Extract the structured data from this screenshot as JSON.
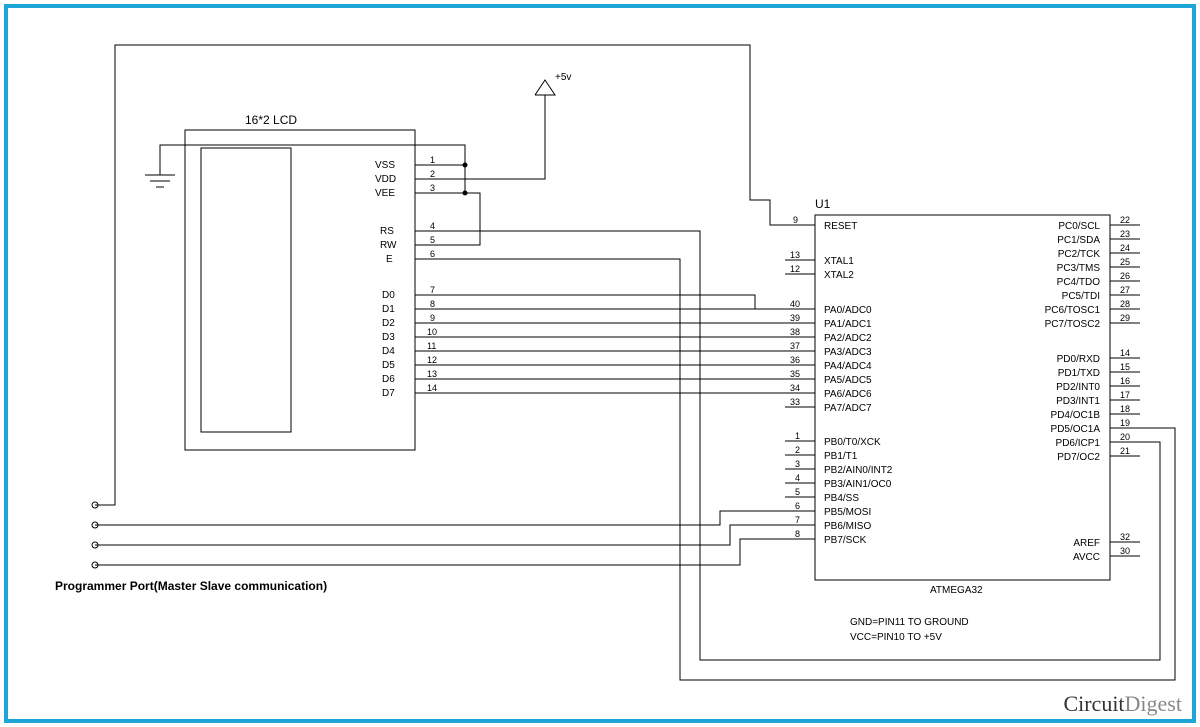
{
  "lcd": {
    "title": "16*2 LCD",
    "pins": [
      "VSS",
      "VDD",
      "VEE",
      "RS",
      "RW",
      "E",
      "D0",
      "D1",
      "D2",
      "D3",
      "D4",
      "D5",
      "D6",
      "D7"
    ]
  },
  "mcu": {
    "ref": "U1",
    "part": "ATMEGA32",
    "left": [
      {
        "num": "9",
        "label": "RESET"
      },
      {
        "num": "13",
        "label": "XTAL1"
      },
      {
        "num": "12",
        "label": "XTAL2"
      },
      {
        "num": "40",
        "label": "PA0/ADC0"
      },
      {
        "num": "39",
        "label": "PA1/ADC1"
      },
      {
        "num": "38",
        "label": "PA2/ADC2"
      },
      {
        "num": "37",
        "label": "PA3/ADC3"
      },
      {
        "num": "36",
        "label": "PA4/ADC4"
      },
      {
        "num": "35",
        "label": "PA5/ADC5"
      },
      {
        "num": "34",
        "label": "PA6/ADC6"
      },
      {
        "num": "33",
        "label": "PA7/ADC7"
      },
      {
        "num": "1",
        "label": "PB0/T0/XCK"
      },
      {
        "num": "2",
        "label": "PB1/T1"
      },
      {
        "num": "3",
        "label": "PB2/AIN0/INT2"
      },
      {
        "num": "4",
        "label": "PB3/AIN1/OC0"
      },
      {
        "num": "5",
        "label": "PB4/SS"
      },
      {
        "num": "6",
        "label": "PB5/MOSI"
      },
      {
        "num": "7",
        "label": "PB6/MISO"
      },
      {
        "num": "8",
        "label": "PB7/SCK"
      }
    ],
    "right": [
      {
        "num": "22",
        "label": "PC0/SCL"
      },
      {
        "num": "23",
        "label": "PC1/SDA"
      },
      {
        "num": "24",
        "label": "PC2/TCK"
      },
      {
        "num": "25",
        "label": "PC3/TMS"
      },
      {
        "num": "26",
        "label": "PC4/TDO"
      },
      {
        "num": "27",
        "label": "PC5/TDI"
      },
      {
        "num": "28",
        "label": "PC6/TOSC1"
      },
      {
        "num": "29",
        "label": "PC7/TOSC2"
      },
      {
        "num": "14",
        "label": "PD0/RXD"
      },
      {
        "num": "15",
        "label": "PD1/TXD"
      },
      {
        "num": "16",
        "label": "PD2/INT0"
      },
      {
        "num": "17",
        "label": "PD3/INT1"
      },
      {
        "num": "18",
        "label": "PD4/OC1B"
      },
      {
        "num": "19",
        "label": "PD5/OC1A"
      },
      {
        "num": "20",
        "label": "PD6/ICP1"
      },
      {
        "num": "21",
        "label": "PD7/OC2"
      },
      {
        "num": "32",
        "label": "AREF"
      },
      {
        "num": "30",
        "label": "AVCC"
      }
    ]
  },
  "labels": {
    "v5": "+5v",
    "port": "Programmer Port(Master Slave communication)",
    "note1": "GND=PIN11 TO GROUND",
    "note2": "VCC=PIN10 TO  +5V",
    "brand1": "Circuit",
    "brand2": "Digest"
  }
}
